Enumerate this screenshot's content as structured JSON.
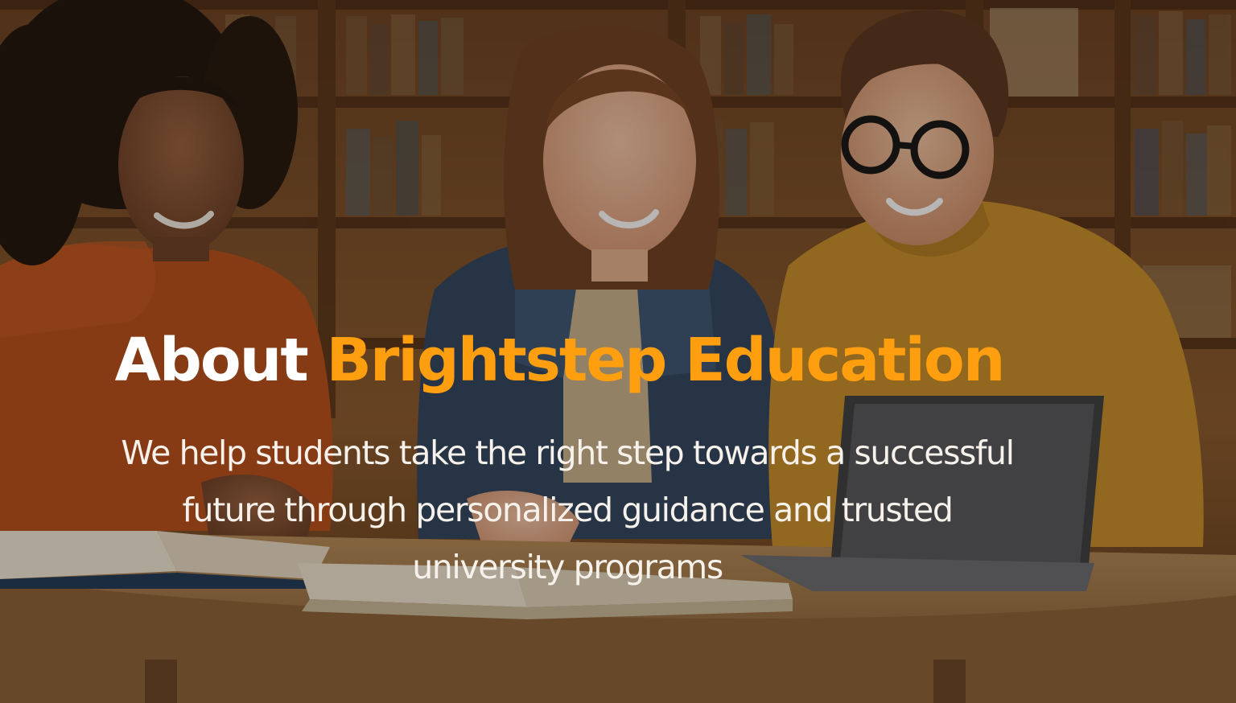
{
  "hero": {
    "title_prefix": "About",
    "title_highlight": "Brightstep Education",
    "subtitle_lines": [
      "We help students take the right step towards a successful",
      "future through personalized guidance and trusted",
      "university programs"
    ]
  },
  "colors": {
    "heading_white": "#ffffff",
    "brand_orange": "#ff9f0f",
    "subtitle_text": "#f6f1ea",
    "overlay": "rgba(20, 12, 6, 0.30)"
  },
  "background": {
    "scene": "three students studying at a library table with books and a laptop"
  }
}
